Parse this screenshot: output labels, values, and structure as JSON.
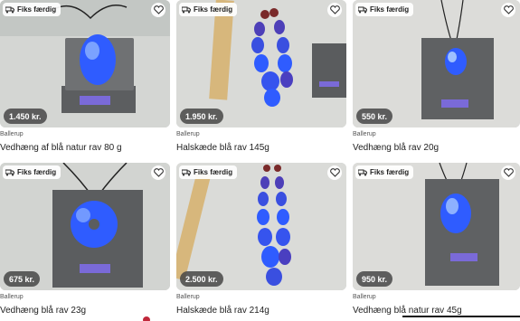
{
  "listings": [
    {
      "badge": "Fiks færdig",
      "price": "1.450 kr.",
      "location": "Ballerup",
      "title": "Vedhæng af blå natur rav 80 g"
    },
    {
      "badge": "Fiks færdig",
      "price": "1.950 kr.",
      "location": "Ballerup",
      "title": "Halskæde blå rav 145g"
    },
    {
      "badge": "Fiks færdig",
      "price": "550 kr.",
      "location": "Ballerup",
      "title": "Vedhæng blå rav 20g"
    },
    {
      "badge": "Fiks færdig",
      "price": "675 kr.",
      "location": "Ballerup",
      "title": "Vedhæng blå rav 23g"
    },
    {
      "badge": "Fiks færdig",
      "price": "2.500 kr.",
      "location": "Ballerup",
      "title": "Halskæde blå rav 214g"
    },
    {
      "badge": "Fiks færdig",
      "price": "950 kr.",
      "location": "Ballerup",
      "title": "Vedhæng blå natur rav 45g"
    }
  ],
  "icons": {
    "badge": "truck-icon",
    "favorite": "heart-icon"
  },
  "colors": {
    "amber_blue": "#2f5cff",
    "price_bg": "#464646"
  }
}
